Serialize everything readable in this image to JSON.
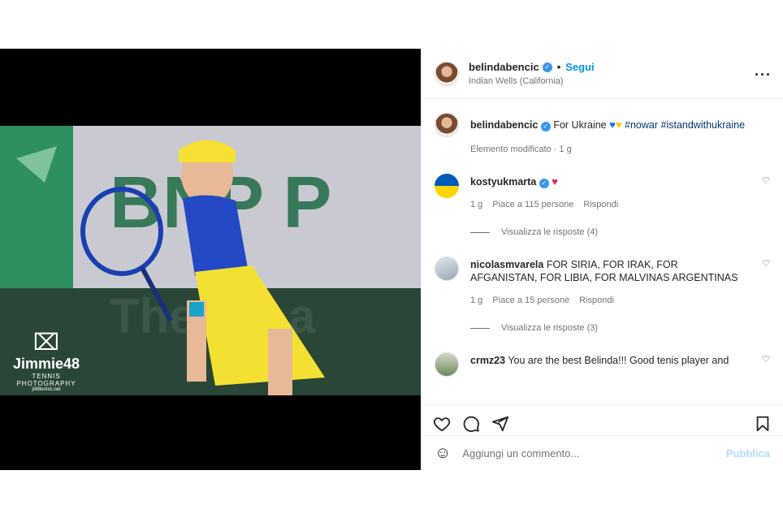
{
  "post": {
    "photo": {
      "watermark_name": "Jimmie48",
      "watermark_tagline": "TENNIS PHOTOGRAPHY",
      "watermark_site": "jl48tennis.net"
    },
    "header": {
      "username": "belindabencic",
      "follow_label": "Segui",
      "location": "Indian Wells (California)",
      "more_icon": "more-horizontal-icon"
    },
    "caption": {
      "username": "belindabencic",
      "text": "For Ukraine",
      "hashtags": "#nowar #istandwithukraine",
      "meta": "Elemento modificato · 1 g"
    },
    "comments": [
      {
        "username": "kostyukmarta",
        "text": "",
        "time": "1 g",
        "likes": "Piace a 115 persone",
        "reply": "Rispondi",
        "view_replies": "Visualizza le risposte (4)"
      },
      {
        "username": "nicolasmvarela",
        "text": "FOR SIRIA, FOR IRAK, FOR AFGANISTAN, FOR LIBIA, FOR MALVINAS ARGENTINAS",
        "time": "1 g",
        "likes": "Piace a 15 persone",
        "reply": "Rispondi",
        "view_replies": "Visualizza le risposte (3)"
      },
      {
        "username": "crmz23",
        "text": "You are the best Belinda!!! Good tenis player and"
      }
    ],
    "add_comment": {
      "placeholder": "Aggiungi un commento...",
      "publish": "Pubblica"
    }
  }
}
